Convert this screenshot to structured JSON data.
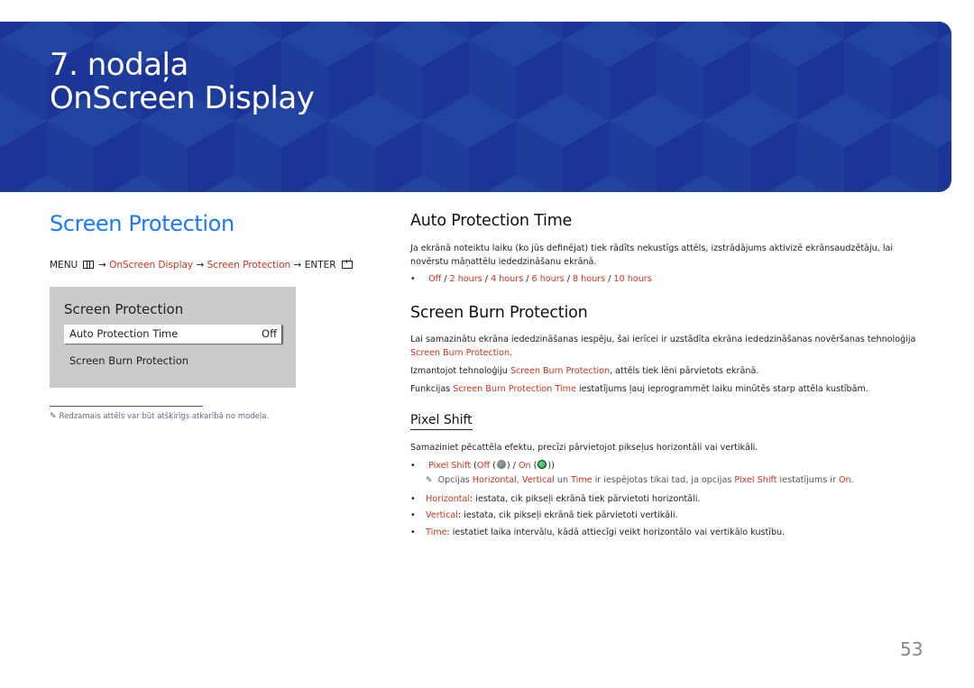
{
  "banner": {
    "chapter": "7. nodaļa",
    "title": "OnScreen Display",
    "colors": {
      "base": "#1e3c9a",
      "light": "#22449e",
      "dark": "#1b3597"
    }
  },
  "left": {
    "section_title": "Screen Protection",
    "menu_path": {
      "menu": "MENU",
      "item1": "OnScreen Display",
      "item2": "Screen Protection",
      "enter": "ENTER",
      "arrow": "→"
    },
    "osd": {
      "title": "Screen Protection",
      "items": [
        {
          "label": "Auto Protection Time",
          "value": "Off",
          "selected": true
        },
        {
          "label": "Screen Burn Protection"
        }
      ]
    },
    "footnote": "Redzamais attēls var būt atšķirīgs atkarībā no modeļa."
  },
  "right": {
    "auto_protection": {
      "heading": "Auto Protection Time",
      "description": "Ja ekrānā noteiktu laiku (ko jūs definējat) tiek rādīts nekustīgs attēls, izstrādājums aktivizē ekrānsaudzētāju, lai novērstu māņattēlu iededzināšanu ekrānā.",
      "options": [
        "Off",
        "2 hours",
        "4 hours",
        "6 hours",
        "8 hours",
        "10 hours"
      ],
      "separator": " / "
    },
    "burn_protection": {
      "heading": "Screen Burn Protection",
      "p1_text": "Lai samazinātu ekrāna iededzināšanas iespēju, šai ierīcei ir uzstādīta ekrāna iededzināšanas novēršanas tehnoloģija ",
      "p1_red": "Screen Burn Protection",
      "p1_end": ".",
      "p2_text": "Izmantojot tehnoloģiju ",
      "p2_red": "Screen Burn Protection",
      "p2_end": ", attēls tiek lēni pārvietots ekrānā.",
      "p3_text": "Funkcijas ",
      "p3_red": "Screen Burn Protection Time",
      "p3_end": " iestatījums ļauj ieprogrammēt laiku minūtēs starp attēla kustībām."
    },
    "pixel_shift": {
      "heading": "Pixel Shift",
      "description": "Samaziniet pēcattēla efektu, precīzi pārvietojot pikseļus horizontāli vai vertikāli.",
      "toggle_label": "Pixel Shift",
      "off": "Off",
      "on": "On",
      "note": {
        "prefix": "Opcijas ",
        "opt1": "Horizontal",
        "sep1": ", ",
        "opt2": "Vertical",
        "sep2": " un ",
        "opt3": "Time",
        "mid": " ir iespējotas tikai tad, ja opcijas ",
        "opt4": "Pixel Shift",
        "mid2": " iestatījums ir ",
        "opt5": "On",
        "end": "."
      },
      "items": [
        {
          "term": "Horizontal",
          "text": ": iestata, cik pikseļi ekrānā tiek pārvietoti horizontāli."
        },
        {
          "term": "Vertical",
          "text": ": iestata, cik pikseļi ekrānā tiek pārvietoti vertikāli."
        },
        {
          "term": "Time",
          "text": ": iestatiet laika intervālu, kādā attiecīgi veikt horizontālo vai vertikālo kustību."
        }
      ]
    }
  },
  "page_number": "53"
}
